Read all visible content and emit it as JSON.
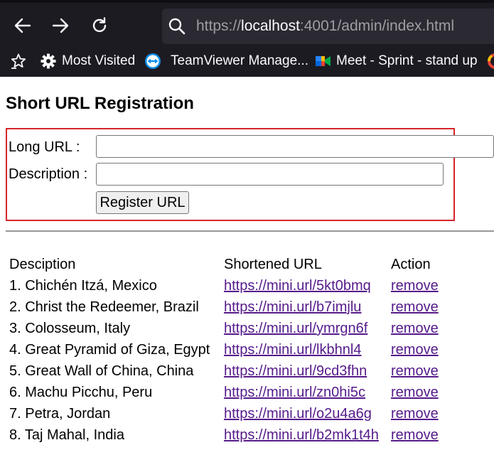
{
  "browser": {
    "url_prefix": "https://",
    "url_host": "localhost",
    "url_rest": ":4001/admin/index.html",
    "bookmarks": [
      {
        "label": "Most Visited",
        "icon": "gear-icon"
      },
      {
        "label": "TeamViewer Manage...",
        "icon": "teamviewer-icon"
      },
      {
        "label": "Meet - Sprint - stand up",
        "icon": "google-meet-icon"
      }
    ],
    "colors": {
      "chrome_bg": "#1c1b22",
      "urlbar_bg": "#2b2a33",
      "url_text": "#fbfbfe",
      "url_dim": "#9e9ea4"
    }
  },
  "page": {
    "title": "Short URL Registration",
    "form": {
      "long_url_label": "Long URL :",
      "long_url_value": "",
      "description_label": "Description :",
      "description_value": "",
      "register_button": "Register URL"
    },
    "table": {
      "headers": [
        "Desciption",
        "Shortened URL",
        "Action"
      ],
      "rows": [
        {
          "description": "1. Chichén Itzá, Mexico",
          "url": "https://mini.url/5kt0bmq",
          "action": "remove"
        },
        {
          "description": "2. Christ the Redeemer, Brazil",
          "url": "https://mini.url/b7imjlu",
          "action": "remove"
        },
        {
          "description": "3. Colosseum, Italy",
          "url": "https://mini.url/ymrgn6f",
          "action": "remove"
        },
        {
          "description": "4. Great Pyramid of Giza, Egypt",
          "url": "https://mini.url/lkbhnl4",
          "action": "remove"
        },
        {
          "description": "5. Great Wall of China, China",
          "url": "https://mini.url/9cd3fhn",
          "action": "remove"
        },
        {
          "description": "6. Machu Picchu, Peru",
          "url": "https://mini.url/zn0hi5c",
          "action": "remove"
        },
        {
          "description": "7. Petra, Jordan",
          "url": "https://mini.url/o2u4a6g",
          "action": "remove"
        },
        {
          "description": "8. Taj Mahal, India",
          "url": "https://mini.url/b2mk1t4h",
          "action": "remove"
        }
      ]
    },
    "colors": {
      "highlight_border": "#d6252a",
      "link": "#551a8b"
    }
  }
}
